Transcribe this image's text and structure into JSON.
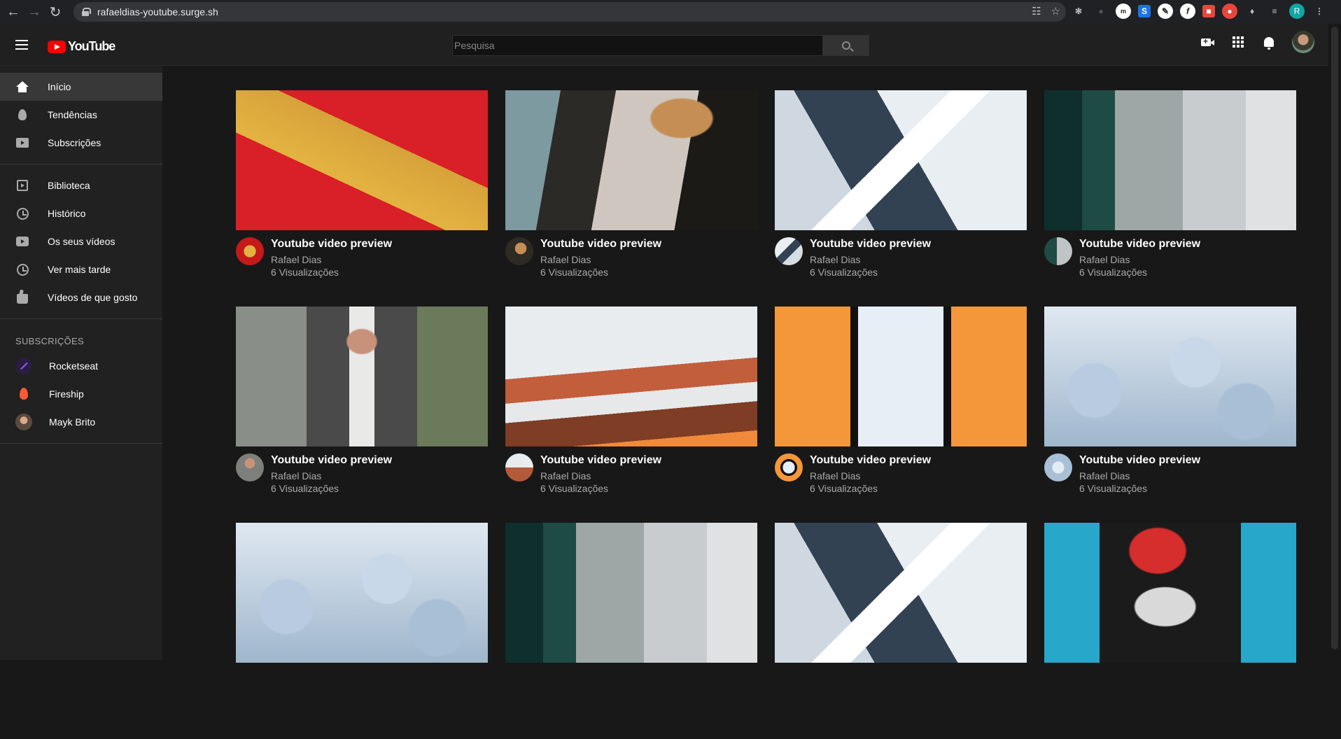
{
  "browser": {
    "url": "rafaeldias-youtube.surge.sh",
    "profile_initial": "R"
  },
  "header": {
    "logo_text": "YouTube",
    "search_placeholder": "Pesquisa"
  },
  "sidebar": {
    "main": [
      {
        "label": "Início",
        "icon": "home-icon",
        "active": true
      },
      {
        "label": "Tendências",
        "icon": "trending-icon"
      },
      {
        "label": "Subscrições",
        "icon": "subscriptions-icon"
      }
    ],
    "library": [
      {
        "label": "Biblioteca",
        "icon": "library-icon"
      },
      {
        "label": "Histórico",
        "icon": "history-icon"
      },
      {
        "label": "Os seus vídeos",
        "icon": "your-videos-icon"
      },
      {
        "label": "Ver mais tarde",
        "icon": "watch-later-icon"
      },
      {
        "label": "Vídeos de que gosto",
        "icon": "liked-videos-icon"
      }
    ],
    "subscriptions_heading": "SUBSCRIÇÕES",
    "subscriptions": [
      {
        "label": "Rocketseat"
      },
      {
        "label": "Fireship"
      },
      {
        "label": "Mayk Brito"
      }
    ]
  },
  "videos": [
    {
      "title": "Youtube video preview",
      "channel": "Rafael Dias",
      "views": "6 Visualizações",
      "thumb": "t-red",
      "avatar": "a-red"
    },
    {
      "title": "Youtube video preview",
      "channel": "Rafael Dias",
      "views": "6 Visualizações",
      "thumb": "t-car",
      "avatar": "a-car"
    },
    {
      "title": "Youtube video preview",
      "channel": "Rafael Dias",
      "views": "6 Visualizações",
      "thumb": "t-mountain",
      "avatar": "a-mountain"
    },
    {
      "title": "Youtube video preview",
      "channel": "Rafael Dias",
      "views": "6 Visualizações",
      "thumb": "t-street",
      "avatar": "a-street"
    },
    {
      "title": "Youtube video preview",
      "channel": "Rafael Dias",
      "views": "6 Visualizações",
      "thumb": "t-man",
      "avatar": "a-man"
    },
    {
      "title": "Youtube video preview",
      "channel": "Rafael Dias",
      "views": "6 Visualizações",
      "thumb": "t-rock",
      "avatar": "a-rock"
    },
    {
      "title": "Youtube video preview",
      "channel": "Rafael Dias",
      "views": "6 Visualizações",
      "thumb": "t-phone",
      "avatar": "a-phone"
    },
    {
      "title": "Youtube video preview",
      "channel": "Rafael Dias",
      "views": "6 Visualizações",
      "thumb": "t-snow",
      "avatar": "a-snow"
    },
    {
      "thumb": "t-snow"
    },
    {
      "thumb": "t-street"
    },
    {
      "thumb": "t-mountain"
    },
    {
      "thumb": "t-chain"
    }
  ]
}
